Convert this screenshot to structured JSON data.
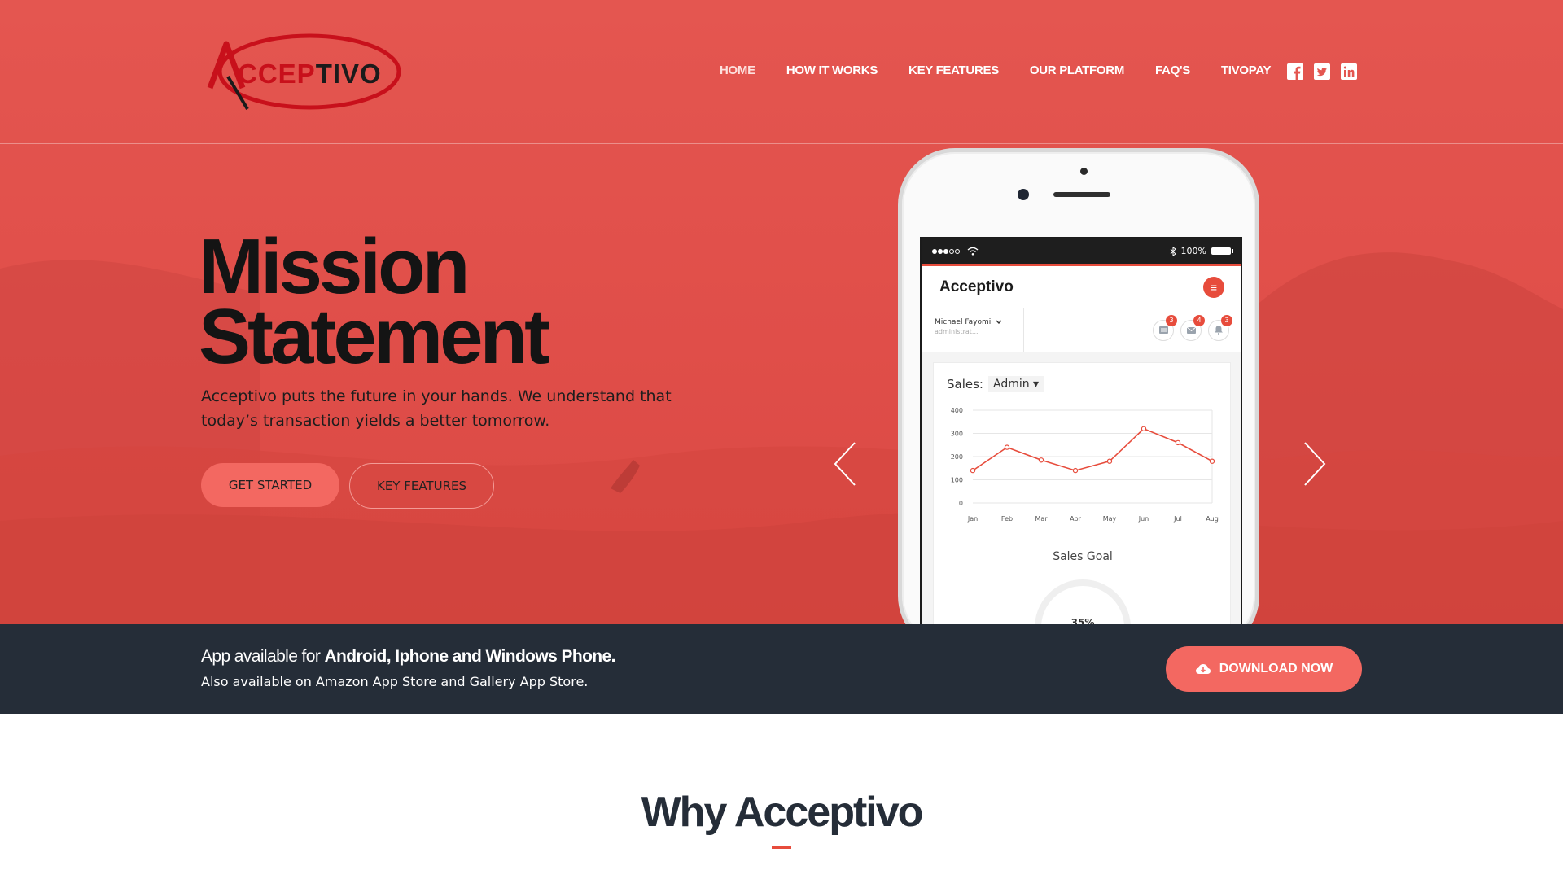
{
  "brand": {
    "logo_text": "ACCEPTIVO",
    "accent_red": "#e74c3c",
    "hero_color": "#e45650",
    "dark_bar": "#252d38"
  },
  "nav": {
    "items": [
      {
        "label": "HOME",
        "active": true
      },
      {
        "label": "HOW IT WORKS"
      },
      {
        "label": "KEY FEATURES"
      },
      {
        "label": "OUR PLATFORM"
      },
      {
        "label": "FAQ'S"
      },
      {
        "label": "TIVOPAY"
      }
    ],
    "social": [
      "facebook-icon",
      "twitter-icon",
      "linkedin-icon"
    ]
  },
  "hero": {
    "title_line1": "Mission",
    "title_line2": "Statement",
    "description": "Acceptivo puts the future in your hands. We understand that today’s transaction yields a better tomorrow.",
    "btn_primary": "GET STARTED",
    "btn_secondary": "KEY FEATURES"
  },
  "phone": {
    "status_battery": "100%",
    "app_title": "Acceptivo",
    "user_name": "Michael Fayomi",
    "user_role": "administrat...",
    "badges": [
      "3",
      "4",
      "3"
    ],
    "sales_label": "Sales:",
    "sales_filter": "Admin",
    "goal_title": "Sales Goal",
    "goal_value": "35%"
  },
  "chart_data": {
    "type": "line",
    "categories": [
      "Jan",
      "Feb",
      "Mar",
      "Apr",
      "May",
      "Jun",
      "Jul",
      "Aug"
    ],
    "series": [
      {
        "values": [
          140,
          240,
          185,
          140,
          180,
          320,
          260,
          180
        ]
      }
    ],
    "ylim": [
      0,
      400
    ],
    "yticks": [
      0,
      100,
      200,
      300,
      400
    ],
    "grid": true,
    "line_color": "#e74c3c"
  },
  "availability": {
    "prefix": "App available for ",
    "platforms": "Android, Iphone and Windows Phone.",
    "subline": "Also available on Amazon App Store and Gallery App Store.",
    "btn_download": "DOWNLOAD NOW"
  },
  "why": {
    "title": "Why Acceptivo"
  }
}
